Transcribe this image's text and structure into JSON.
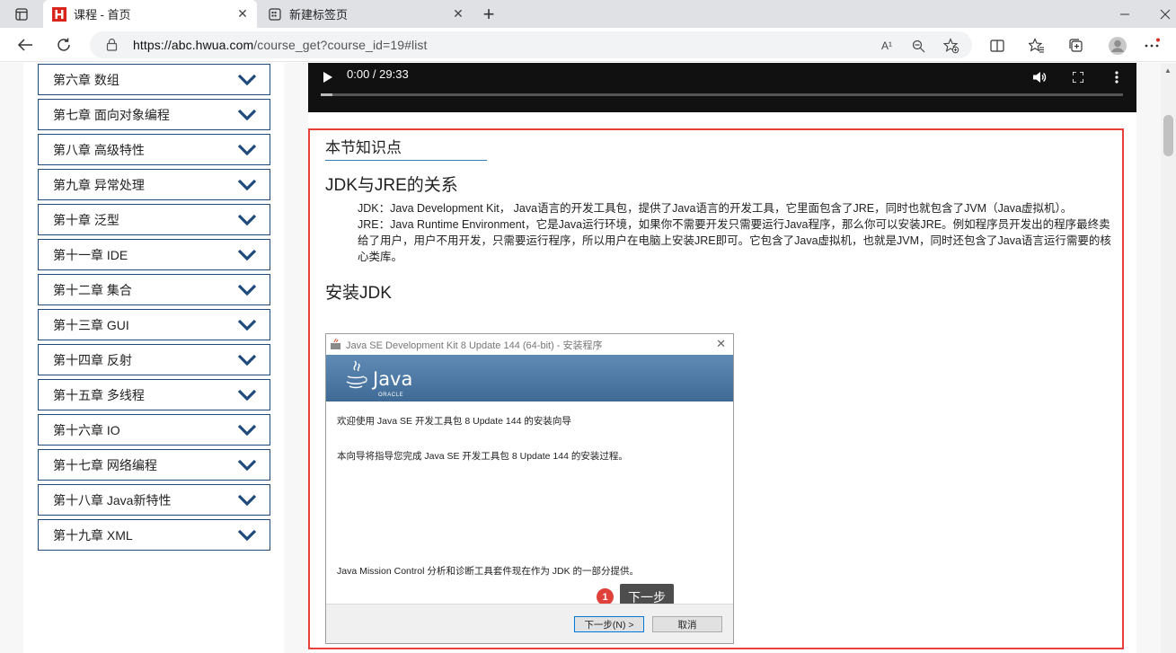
{
  "browser": {
    "tabs": [
      {
        "label": "课程 - 首页",
        "active": true
      },
      {
        "label": "新建标签页",
        "active": false
      }
    ],
    "url_host": "https://abc.hwua.com",
    "url_path": "/course_get?course_id=19#list",
    "read_aloud_label": "A¹"
  },
  "sidebar": {
    "chapters": [
      "第六章 数组",
      "第七章 面向对象编程",
      "第八章 高级特性",
      "第九章 异常处理",
      "第十章 泛型",
      "第十一章 IDE",
      "第十二章 集合",
      "第十三章 GUI",
      "第十四章 反射",
      "第十五章 多线程",
      "第十六章 IO",
      "第十七章 网络编程",
      "第十八章 Java新特性",
      "第十九章 XML"
    ]
  },
  "video": {
    "time": "0:00 / 29:33",
    "progress": 0.015
  },
  "knowledge": {
    "title": "本节知识点",
    "section1_heading": "JDK与JRE的关系",
    "jdk_text": "JDK：Java Development Kit， Java语言的开发工具包，提供了Java语言的开发工具，它里面包含了JRE，同时也就包含了JVM（Java虚拟机）。",
    "jre_text": "JRE：Java Runtime Environment，它是Java运行环境，如果你不需要开发只需要运行Java程序，那么你可以安装JRE。例如程序员开发出的程序最终卖给了用户，用户不用开发，只需要运行程序，所以用户在电脑上安装JRE即可。它包含了Java虚拟机，也就是JVM，同时还包含了Java语言运行需要的核心类库。",
    "section2_heading": "安装JDK"
  },
  "installer": {
    "window_title": "Java SE Development Kit 8 Update 144 (64-bit) - 安装程序",
    "logo_text": "Java",
    "logo_sub": "ORACLE",
    "welcome": "欢迎使用 Java SE 开发工具包 8 Update 144 的安装向导",
    "guide": "本向导将指导您完成 Java SE 开发工具包 8 Update 144 的安装过程。",
    "mission_control": "Java Mission Control 分析和诊断工具套件现在作为 JDK 的一部分提供。",
    "next_button": "下一步(N) >",
    "cancel_button": "取消",
    "tooltip": "下一步",
    "step_badge": "1"
  }
}
